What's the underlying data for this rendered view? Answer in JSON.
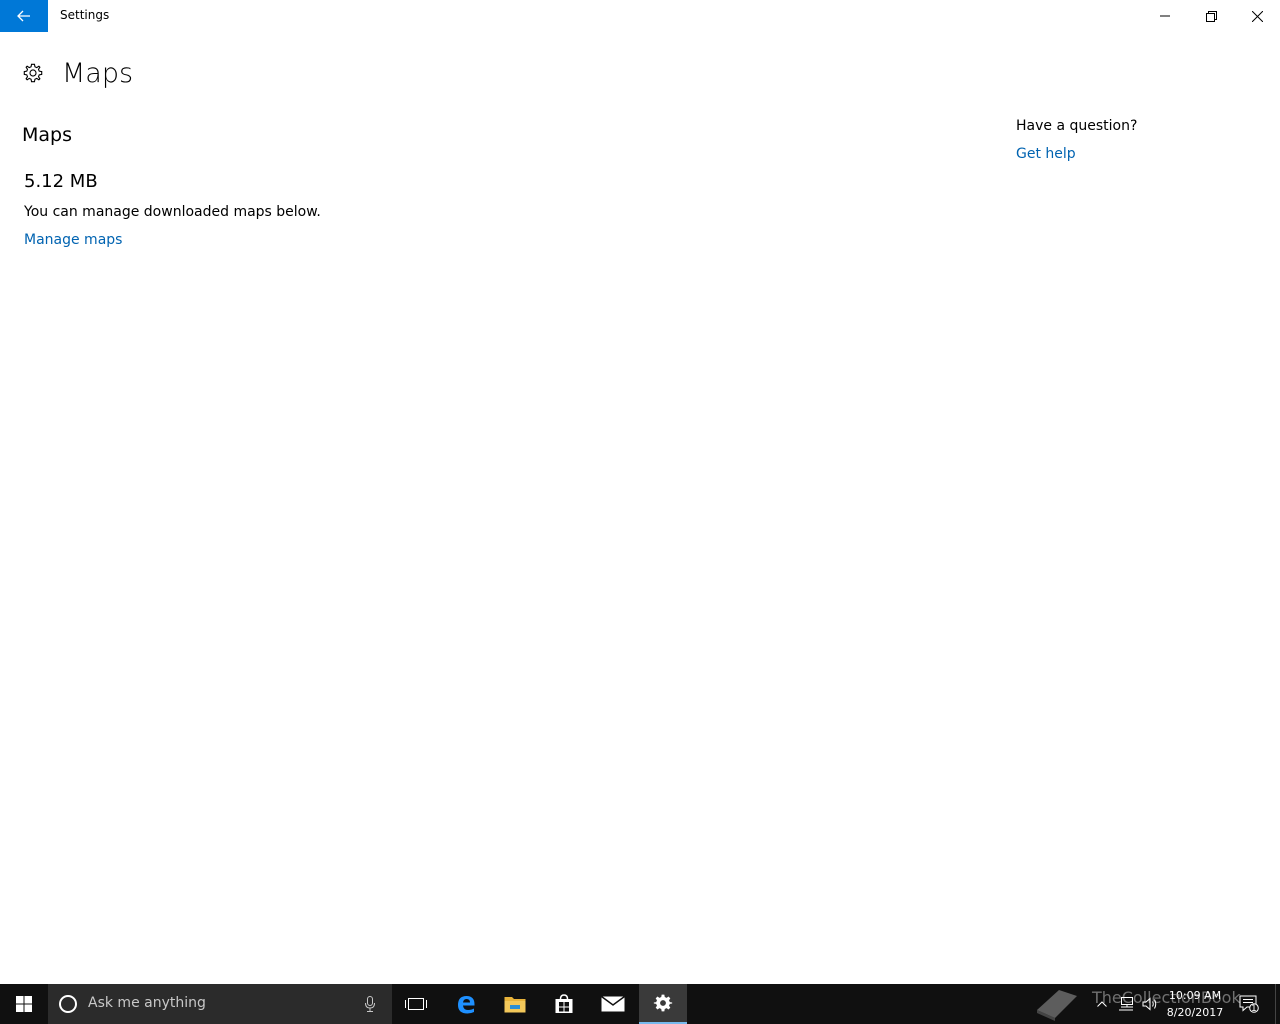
{
  "window": {
    "title": "Settings"
  },
  "page": {
    "title": "Maps",
    "section_title": "Maps",
    "storage_size": "5.12 MB",
    "description": "You can manage downloaded maps below.",
    "manage_link": "Manage maps"
  },
  "help": {
    "question": "Have a question?",
    "link": "Get help"
  },
  "taskbar": {
    "search_placeholder": "Ask me anything",
    "time": "10:09 AM",
    "date": "8/20/2017",
    "notification_count": "1",
    "watermark": "TheCollectionBook"
  },
  "colors": {
    "accent": "#0078d7",
    "link": "#0063b1",
    "taskbar": "#101010"
  },
  "icons": {
    "back": "arrow-left-icon",
    "minimize": "minimize-icon",
    "restore": "restore-icon",
    "close": "close-icon",
    "page": "gear-icon",
    "start": "windows-logo-icon",
    "cortana": "cortana-circle-icon",
    "mic": "microphone-icon",
    "task_view": "task-view-icon",
    "edge": "edge-icon",
    "explorer": "folder-icon",
    "store": "store-icon",
    "mail": "mail-icon",
    "settings": "gear-icon"
  }
}
